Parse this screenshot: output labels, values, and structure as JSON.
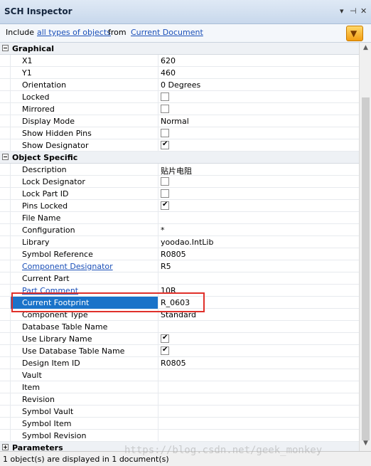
{
  "panel": {
    "title": "SCH Inspector",
    "icons": [
      "dropdown-arrow-icon",
      "pin-icon",
      "close-icon"
    ],
    "dropdown_glyph": "▾",
    "pin_glyph": "⊣",
    "close_glyph": "✕"
  },
  "include_bar": {
    "prefix": "Include",
    "types_link": "all types of objects",
    "middle": "from",
    "scope_link": "Current Document",
    "filter_icon": "funnel-icon",
    "filter_glyph": "▼"
  },
  "categories": {
    "graphical": {
      "label": "Graphical",
      "rows": [
        {
          "label": "X1",
          "value": "620"
        },
        {
          "label": "Y1",
          "value": "460"
        },
        {
          "label": "Orientation",
          "value": "0 Degrees"
        },
        {
          "label": "Locked",
          "checkbox": false
        },
        {
          "label": "Mirrored",
          "checkbox": false
        },
        {
          "label": "Display Mode",
          "value": "Normal"
        },
        {
          "label": "Show Hidden Pins",
          "checkbox": false
        },
        {
          "label": "Show Designator",
          "checkbox": true
        }
      ]
    },
    "object_specific": {
      "label": "Object Specific",
      "rows": [
        {
          "label": "Description",
          "value": "贴片电阻"
        },
        {
          "label": "Lock Designator",
          "checkbox": false
        },
        {
          "label": "Lock Part ID",
          "checkbox": false
        },
        {
          "label": "Pins Locked",
          "checkbox": true
        },
        {
          "label": "File Name",
          "value": ""
        },
        {
          "label": "Configuration",
          "value": "*"
        },
        {
          "label": "Library",
          "value": "yoodao.IntLib"
        },
        {
          "label": "Symbol Reference",
          "value": "R0805"
        },
        {
          "label": "Component Designator",
          "value": "R5"
        },
        {
          "label": "Current Part",
          "value": ""
        },
        {
          "label": "Part Comment",
          "value": "10R"
        },
        {
          "label": "Current Footprint",
          "value": "R_0603"
        },
        {
          "label": "Component Type",
          "value": "Standard"
        },
        {
          "label": "Database Table Name",
          "value": ""
        },
        {
          "label": "Use Library Name",
          "checkbox": true
        },
        {
          "label": "Use Database Table Name",
          "checkbox": true
        },
        {
          "label": "Design Item ID",
          "value": "R0805"
        },
        {
          "label": "Vault",
          "value": ""
        },
        {
          "label": "Item",
          "value": ""
        },
        {
          "label": "Revision",
          "value": ""
        },
        {
          "label": "Symbol Vault",
          "value": ""
        },
        {
          "label": "Symbol Item",
          "value": ""
        },
        {
          "label": "Symbol Revision",
          "value": ""
        }
      ]
    },
    "parameters": {
      "label": "Parameters"
    }
  },
  "status": {
    "text": "1 object(s) are displayed in 1 document(s)"
  },
  "watermark": "https://blog.csdn.net/geek_monkey",
  "colors": {
    "selection": "#1a73c9",
    "highlight_box": "#e0302a",
    "link": "#1a4fb8"
  }
}
